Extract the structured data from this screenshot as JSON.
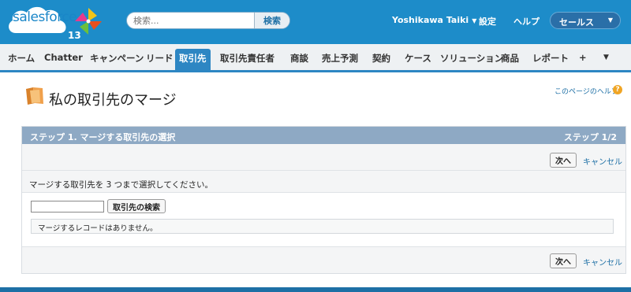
{
  "header": {
    "logo_text": "salesforce",
    "logo_version": "13",
    "search_placeholder": "検索...",
    "search_button": "検索",
    "user_name": "Yoshikawa Taiki",
    "setup_link": "設定",
    "help_link": "ヘルプ",
    "app_menu": "セールス"
  },
  "tabs": [
    {
      "label": "ホーム"
    },
    {
      "label": "Chatter"
    },
    {
      "label": "キャンペーン"
    },
    {
      "label": "リード"
    },
    {
      "label": "取引先",
      "active": true
    },
    {
      "label": "取引先責任者"
    },
    {
      "label": "商談"
    },
    {
      "label": "売上予測"
    },
    {
      "label": "契約"
    },
    {
      "label": "ケース"
    },
    {
      "label": "ソリューション"
    },
    {
      "label": "商品"
    },
    {
      "label": "レポート"
    },
    {
      "label": "+"
    },
    {
      "label": "▼"
    }
  ],
  "page": {
    "title": "私の取引先のマージ",
    "help_link": "このページのヘルプ",
    "help_icon": "?"
  },
  "panel": {
    "step_label": "ステップ 1. マージする取引先の選択",
    "step_count": "ステップ 1/2",
    "next_button": "次へ",
    "cancel_link": "キャンセル",
    "instruction": "マージする取引先を 3 つまで選択してください。",
    "search_input_value": "",
    "search_button": "取引先の検索",
    "no_records": "マージするレコードはありません。"
  },
  "colors": {
    "header_bg": "#1d8cc9",
    "tab_active": "#2d86c3",
    "panel_header": "#8ea9c4",
    "link": "#1d6fa5"
  }
}
